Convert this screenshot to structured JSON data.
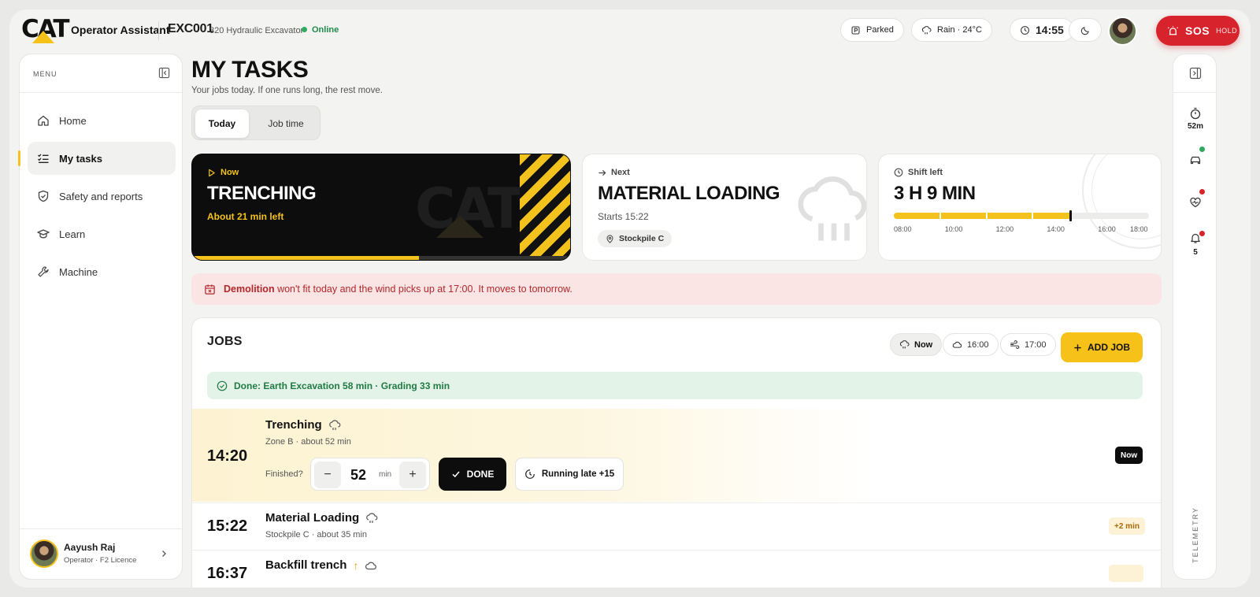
{
  "header": {
    "brand": "CAT",
    "app_title": "Operator Assistant",
    "machine_id": "EXC001",
    "machine_model": "320 Hydraulic Excavator",
    "status": "Online",
    "parked": "Parked",
    "weather": "Rain · 24°C",
    "time": "14:55",
    "sos_label": "SOS",
    "sos_hold": "HOLD"
  },
  "sidebar": {
    "menu_label": "MENU",
    "items": [
      {
        "label": "Home",
        "icon": "home-icon"
      },
      {
        "label": "My tasks",
        "icon": "checklist-icon",
        "active": true
      },
      {
        "label": "Safety and reports",
        "icon": "shield-icon"
      },
      {
        "label": "Learn",
        "icon": "graduation-cap-icon"
      },
      {
        "label": "Machine",
        "icon": "wrench-icon"
      }
    ],
    "user": {
      "name": "Aayush Raj",
      "role": "Operator · F2 Licence"
    }
  },
  "rail": {
    "timer_value": "52m",
    "notifications_count": "5",
    "telemetry_label": "TELEMETRY"
  },
  "main": {
    "title": "MY TASKS",
    "subtitle": "Your jobs today. If one runs long, the rest move.",
    "tabs": [
      {
        "label": "Today",
        "selected": true
      },
      {
        "label": "Job time",
        "selected": false
      }
    ],
    "now_card": {
      "label": "Now",
      "title": "TRENCHING",
      "sub": "About 21 min left",
      "watermark": "CAT",
      "progress": 0.6
    },
    "next_card": {
      "label": "Next",
      "title": "MATERIAL LOADING",
      "sub": "Starts 15:22",
      "location": "Stockpile C"
    },
    "shift_card": {
      "label": "Shift left",
      "title": "3 H 9 MIN",
      "ticks": [
        "08:00",
        "10:00",
        "12:00",
        "14:00",
        "16:00",
        "18:00"
      ],
      "progress": 0.69
    },
    "alert": {
      "bold": "Demolition",
      "text": " won't fit today and the wind picks up at 17:00. It moves to tomorrow."
    },
    "jobs": {
      "title": "JOBS",
      "weather_chips": [
        {
          "label": "Now",
          "icon": "rain-cloud-icon",
          "selected": true
        },
        {
          "label": "16:00",
          "icon": "cloud-icon",
          "selected": false
        },
        {
          "label": "17:00",
          "icon": "wind-icon",
          "selected": false
        }
      ],
      "add_label": "ADD JOB",
      "done_summary": "Done: Earth Excavation 58 min · Grading 33 min",
      "current": {
        "time": "14:20",
        "title": "Trenching",
        "sub": "Zone B · about 52 min",
        "finished_label": "Finished?",
        "minutes": "52",
        "unit": "min",
        "minus": "−",
        "plus": "+",
        "done_label": "DONE",
        "late_label": "Running late +15",
        "badge": "Now"
      },
      "rows": [
        {
          "time": "15:22",
          "title": "Material Loading",
          "sub": "Stockpile C · about 35 min",
          "badge": "+2 min"
        },
        {
          "time": "16:37",
          "title": "Backfill trench",
          "sub": "",
          "badge": ""
        }
      ]
    }
  }
}
